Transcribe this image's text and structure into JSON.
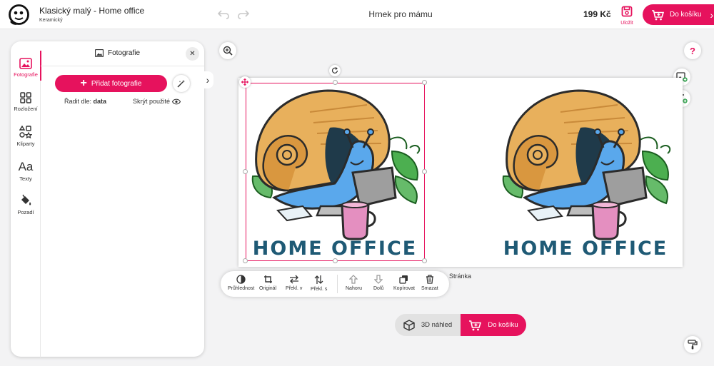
{
  "header": {
    "title": "Klasický malý - Home office",
    "subtitle": "Keramický",
    "doc_title": "Hrnek pro mámu",
    "price": "199 Kč",
    "save_label": "Uložit",
    "cart_label": "Do košíku"
  },
  "sidebar": {
    "tabs": [
      {
        "label": "Fotografie",
        "icon": "image-icon"
      },
      {
        "label": "Rozložení",
        "icon": "layout-icon"
      },
      {
        "label": "Kliparty",
        "icon": "shapes-icon"
      },
      {
        "label": "Texty",
        "icon": "text-aa-icon"
      },
      {
        "label": "Pozadí",
        "icon": "paint-bucket-icon"
      }
    ],
    "active": "Fotografie"
  },
  "panel": {
    "title": "Fotografie",
    "add_photo": "Přidat fotografie",
    "sort_label": "Řadit dle:",
    "sort_value": "data",
    "hide_used": "Skrýt použité"
  },
  "canvas": {
    "image_text": "HOME OFFICE",
    "page_label": "Stránka"
  },
  "toolbar": {
    "items": [
      "Průhlednost",
      "Originál",
      "Překl. v",
      "Překl. s",
      "Nahoru",
      "Dolů",
      "Kopírovat",
      "Smazat"
    ]
  },
  "bottom": {
    "preview_label": "3D náhled",
    "cart_label": "Do košíku"
  },
  "colors": {
    "accent": "#e6125d",
    "text_dark": "#222222",
    "snail_shell": "#e8b05c",
    "snail_body": "#5aa8ec",
    "logo_text": "#1f5a75"
  }
}
